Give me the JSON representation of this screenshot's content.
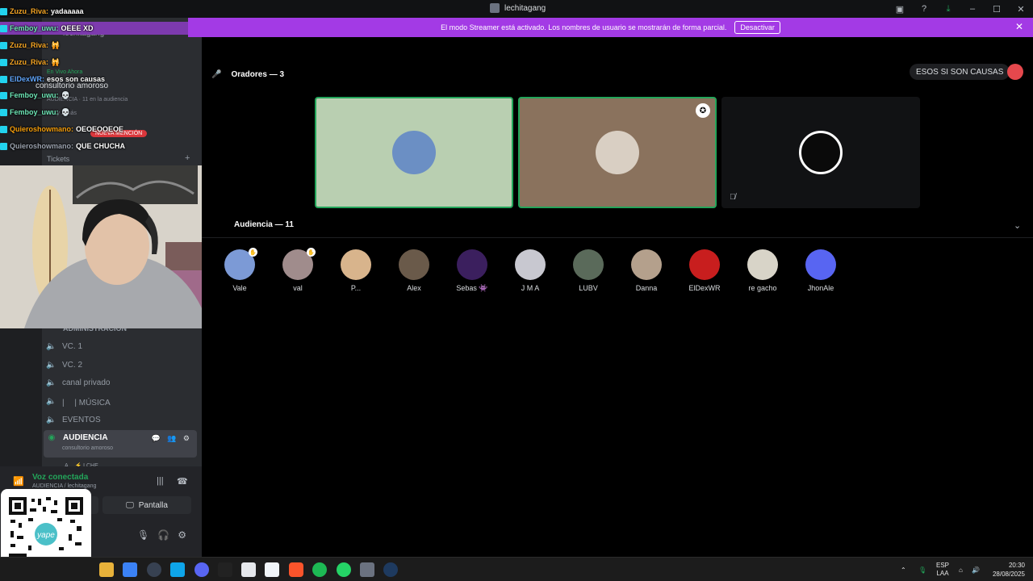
{
  "window": {
    "title": "lechitagang",
    "controls": {
      "minimize": "–",
      "maximize": "☐",
      "close": "✕"
    }
  },
  "banner": {
    "text": "El modo Streamer está activado. Los nombres de usuario se mostrarán de forma parcial.",
    "button": "Desactivar",
    "close": "✕"
  },
  "sidebar": {
    "server_name": "lechitagang",
    "live_now": "En Vivo Ahora",
    "live_channel": "consultorio amoroso",
    "live_meta": "AUDIENCIA · 11 en la audiencia",
    "live_time": "A... y 2 más",
    "new_mention": "NUEVA MENCIÓN",
    "tickets": "Tickets",
    "tickets_add": "+",
    "category": "ADMINISTRACIÓN",
    "channels": [
      {
        "name": "VC. 1"
      },
      {
        "name": "VC. 2"
      },
      {
        "name": "canal privado"
      },
      {
        "name": "| 　| MÚSICA"
      },
      {
        "name": "EVENTOS"
      }
    ],
    "active_channel": {
      "name": "AUDIENCIA",
      "subtitle": "consultorio amoroso",
      "actions": "💬 👥 ⚙"
    },
    "below_active": "A... ⚡ LCHE"
  },
  "chat": [
    {
      "user": "Zuzu_Riva:",
      "msg": "yadaaaaa",
      "color": "#f5a524"
    },
    {
      "user": "Femboy_uwu:",
      "msg": "OEEE XD",
      "color": "#6ee7b7",
      "highlight": true
    },
    {
      "user": "Zuzu_Riva:",
      "msg": "🙀",
      "color": "#f5a524"
    },
    {
      "user": "Zuzu_Riva:",
      "msg": "🙀",
      "color": "#f5a524"
    },
    {
      "user": "ElDexWR:",
      "msg": "esos son causas",
      "color": "#60a5fa"
    },
    {
      "user": "Femboy_uwu:",
      "msg": "💀",
      "color": "#6ee7b7"
    },
    {
      "user": "Femboy_uwu:",
      "msg": "💀",
      "color": "#6ee7b7"
    },
    {
      "user": "Quieroshowmano:",
      "msg": "OEOEOOEOE",
      "color": "#f59e0b"
    },
    {
      "user": "Quieroshowmano:",
      "msg": "QUE CHUCHA",
      "color": "#9ca3af"
    }
  ],
  "voice": {
    "status": "Voz conectada",
    "location": "AUDIENCIA / lechitagang",
    "screen_button": "Pantalla"
  },
  "stage": {
    "speakers_label": "Oradores — 3",
    "topic_button": "ESOS SI SON CAUSAS",
    "audience_label": "Audiencia — 11",
    "speakers": [
      {
        "bg": "#b9cfb1",
        "avatar": "#6b8fc4",
        "speaking": true,
        "moderator": false
      },
      {
        "bg": "#8a725d",
        "avatar": "#d9cfc3",
        "speaking": true,
        "moderator": true
      },
      {
        "bg": "#111214",
        "avatar": "#0a0a0a",
        "speaking": false,
        "moderator": false,
        "muted": true
      }
    ],
    "audience": [
      {
        "name": "Vale",
        "color": "#7c9ad6",
        "hand": true
      },
      {
        "name": "val",
        "color": "#a08c8c",
        "hand": true
      },
      {
        "name": "P...",
        "color": "#d8b48c"
      },
      {
        "name": "Alex",
        "color": "#6a5a4a"
      },
      {
        "name": "Sebas 👾",
        "color": "#3b1f5e"
      },
      {
        "name": "J M A",
        "color": "#c8c8d0"
      },
      {
        "name": "LUBV",
        "color": "#5a6a5a"
      },
      {
        "name": "Danna",
        "color": "#b4a08c"
      },
      {
        "name": "ElDexWR",
        "color": "#c81e1e"
      },
      {
        "name": "re gacho",
        "color": "#d8d4c8"
      },
      {
        "name": "JhonAle",
        "color": "#5865f2"
      }
    ]
  },
  "taskbar": {
    "lang": "ESP",
    "lang2": "LAA",
    "time": "20:30",
    "date": "28/08/2025"
  }
}
